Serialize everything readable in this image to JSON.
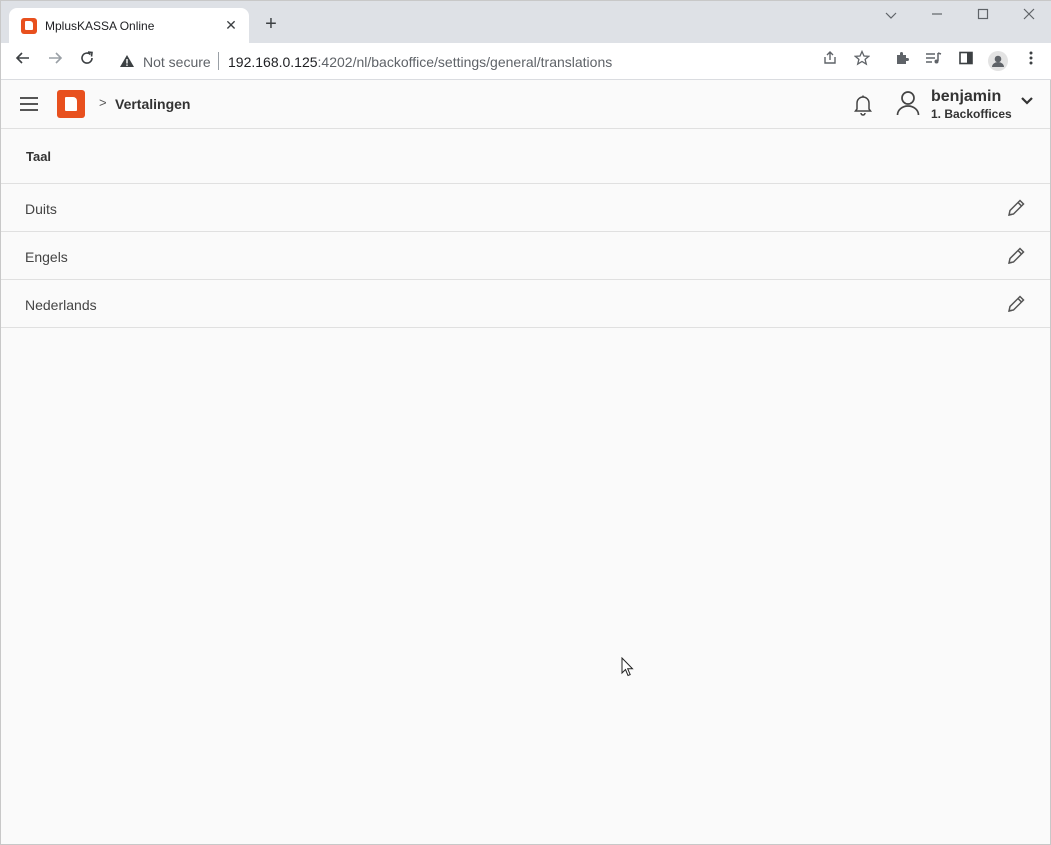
{
  "browser": {
    "tab_title": "MplusKASSA Online",
    "tab_close": "✕",
    "new_tab": "+",
    "security_label": "Not secure",
    "url_host": "192.168.0.125",
    "url_rest": ":4202/nl/backoffice/settings/general/translations"
  },
  "header": {
    "breadcrumb_chevron": ">",
    "page_title": "Vertalingen",
    "user_name": "benjamin",
    "user_role": "1. Backoffices"
  },
  "table": {
    "column_header": "Taal",
    "rows": [
      {
        "label": "Duits"
      },
      {
        "label": "Engels"
      },
      {
        "label": "Nederlands"
      }
    ]
  },
  "colors": {
    "brand": "#e8501e",
    "background": "#fafafa"
  }
}
